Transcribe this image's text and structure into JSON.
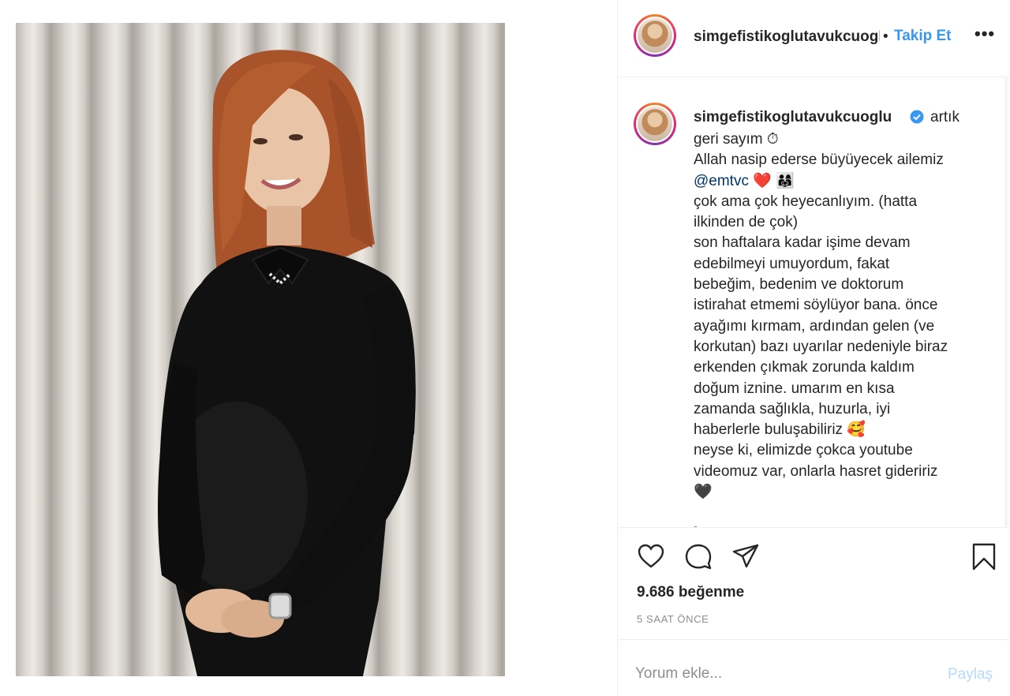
{
  "post": {
    "username_header": "simgefistikoglutavukcuoglu",
    "separator": "•",
    "follow_label": "Takip Et",
    "more_label": "•••",
    "caption": {
      "username": "simgefistikoglutavukcuoglu",
      "first_text": "artık",
      "lines": [
        "geri sayım ⏱",
        "Allah nasip ederse büyüyecek ailemiz",
        "@emtvc ❤️ 👨‍👩‍👧",
        "çok ama çok heyecanlıyım. (hatta",
        "ilkinden de çok)",
        "son haftalara kadar işime devam",
        "edebilmeyi umuyordum, fakat",
        "bebeğim, bedenim ve doktorum",
        "istirahat etmemi söylüyor bana. önce",
        "ayağımı kırmam, ardından gelen (ve",
        "korkutan) bazı uyarılar nedeniyle biraz",
        "erkenden çıkmak zorunda kaldım",
        "doğum iznine. umarım en kısa",
        "zamanda sağlıkla, huzurla, iyi",
        "haberlerle buluşabiliriz 🥰",
        "neyse ki, elimizde çokca youtube",
        "videomuz var, onlarla hasret gideririz",
        "🖤"
      ],
      "mention": "@emtvc",
      "more_indicator": "-"
    },
    "likes_text": "9.686 beğenme",
    "time_text": "5 SAAT ÖNCE",
    "comment_placeholder": "Yorum ekle...",
    "share_label": "Paylaş",
    "icons": {
      "like": "heart-outline-icon",
      "comment": "speech-bubble-icon",
      "share": "paper-plane-icon",
      "save": "bookmark-icon",
      "verified": "verified-badge-icon"
    },
    "colors": {
      "link": "#3897f0",
      "verified": "#3897f0",
      "mention": "#003569",
      "muted": "#8e8e8e"
    }
  }
}
